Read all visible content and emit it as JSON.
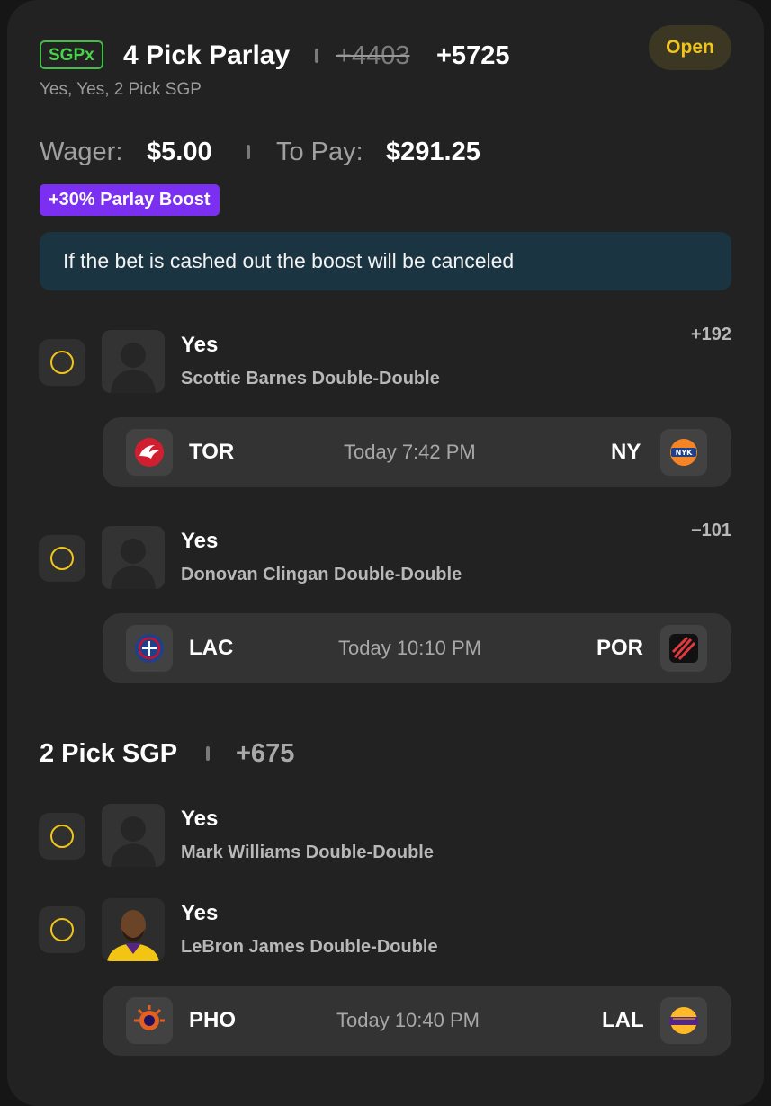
{
  "bet": {
    "badge": "SGPx",
    "title": "4 Pick Parlay",
    "original_odds": "+4403",
    "boosted_odds": "+5725",
    "subtitle": "Yes, Yes, 2 Pick SGP",
    "status": "Open",
    "wager_label": "Wager:",
    "wager_value": "$5.00",
    "topay_label": "To Pay:",
    "topay_value": "$291.25",
    "boost_label": "+30% Parlay Boost",
    "notice": "If the bet is cashed out the boost will be canceled"
  },
  "legs": [
    {
      "pick": "Yes",
      "market": "Scottie Barnes Double-Double",
      "odds": "+192",
      "game": {
        "home": "TOR",
        "time": "Today 7:42 PM",
        "away": "NY"
      }
    },
    {
      "pick": "Yes",
      "market": "Donovan Clingan Double-Double",
      "odds": "−101",
      "game": {
        "home": "LAC",
        "time": "Today 10:10 PM",
        "away": "POR"
      }
    }
  ],
  "sgp": {
    "title": "2 Pick SGP",
    "odds": "+675",
    "legs": [
      {
        "pick": "Yes",
        "market": "Mark Williams Double-Double"
      },
      {
        "pick": "Yes",
        "market": "LeBron James Double-Double"
      }
    ],
    "game": {
      "home": "PHO",
      "time": "Today 10:40 PM",
      "away": "LAL"
    }
  },
  "colors": {
    "accent_yellow": "#f0c419",
    "sgpx_green": "#49d24c",
    "boost_purple": "#7b2ff0",
    "notice_bg": "#1b3442"
  },
  "icons": {
    "team_logos": [
      "raptors-logo-icon",
      "knicks-logo-icon",
      "clippers-logo-icon",
      "blazers-logo-icon",
      "suns-logo-icon",
      "lakers-logo-icon"
    ],
    "avatars": [
      "player-silhouette-icon",
      "player-silhouette-icon",
      "player-silhouette-icon",
      "lebron-headshot"
    ]
  }
}
